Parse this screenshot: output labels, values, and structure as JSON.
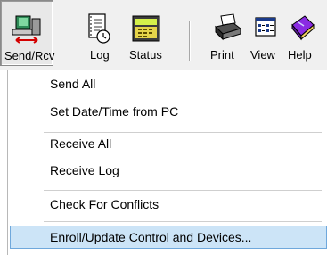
{
  "toolbar": {
    "send_rcv_label": "Send/Rcv",
    "log_label": "Log",
    "status_label": "Status",
    "print_label": "Print",
    "view_label": "View",
    "help_label": "Help"
  },
  "icons": {
    "send_rcv": "computer-transfer-icon",
    "log": "log-book-icon",
    "status": "status-panel-icon",
    "print": "printer-icon",
    "view": "view-list-icon",
    "help": "help-book-icon"
  },
  "menu": {
    "send_all": "Send All",
    "set_date_time": "Set Date/Time from PC",
    "receive_all": "Receive All",
    "receive_log": "Receive Log",
    "check_conflicts": "Check For Conflicts",
    "enroll_update": "Enroll/Update Control and Devices..."
  },
  "colors": {
    "highlight_bg": "#cce4f7",
    "highlight_border": "#6fa8dc",
    "toolbar_bg": "#f0f0f0"
  }
}
